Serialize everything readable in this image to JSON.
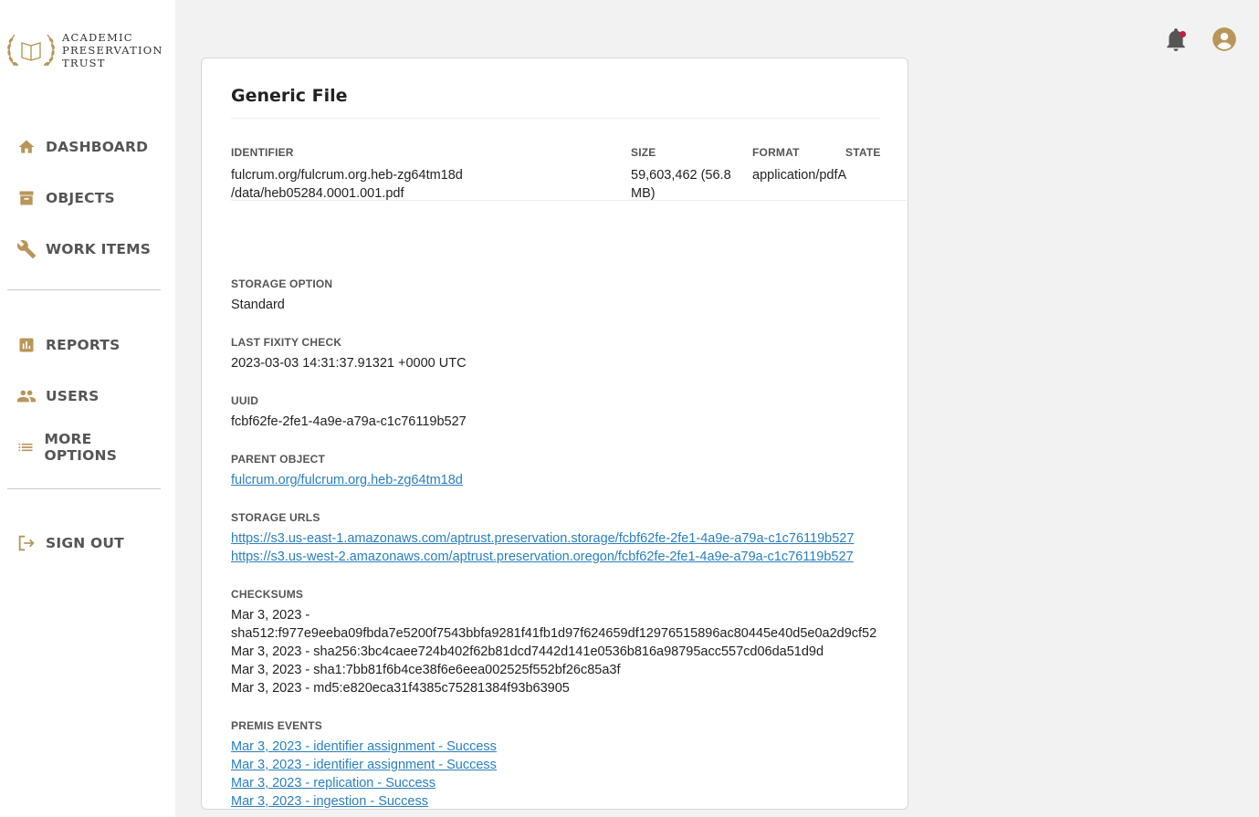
{
  "brand": {
    "line1": "ACADEMIC",
    "line2": "PRESERVATION",
    "line3": "TRUST"
  },
  "nav_primary": [
    {
      "label": "DASHBOARD",
      "icon": "home-icon"
    },
    {
      "label": "OBJECTS",
      "icon": "archive-box-icon"
    },
    {
      "label": "WORK ITEMS",
      "icon": "wrench-icon"
    }
  ],
  "nav_secondary": [
    {
      "label": "REPORTS",
      "icon": "bar-chart-icon"
    },
    {
      "label": "USERS",
      "icon": "users-icon"
    },
    {
      "label": "MORE OPTIONS",
      "icon": "list-icon"
    }
  ],
  "nav_signout": {
    "label": "SIGN OUT",
    "icon": "sign-out-icon"
  },
  "colors": {
    "accent": "#b8965a",
    "link": "#2a7fbf",
    "notification": "#c0203b"
  },
  "card": {
    "title": "Generic File",
    "headers": {
      "identifier": "IDENTIFIER",
      "size": "SIZE",
      "format": "FORMAT",
      "state": "STATE"
    },
    "identifier_line1": "fulcrum.org/fulcrum.org.heb-zg64tm18d",
    "identifier_line2": "/data/heb05284.0001.001.pdf",
    "size_line1": "59,603,462 (56.8",
    "size_line2": "MB)",
    "format": "application/pdfA",
    "state": "",
    "storage_option": {
      "label": "STORAGE OPTION",
      "value": "Standard"
    },
    "last_fixity": {
      "label": "LAST FIXITY CHECK",
      "value": "2023-03-03 14:31:37.91321 +0000 UTC"
    },
    "uuid": {
      "label": "UUID",
      "value": "fcbf62fe-2fe1-4a9e-a79a-c1c76119b527"
    },
    "parent_object": {
      "label": "PARENT OBJECT",
      "value": "fulcrum.org/fulcrum.org.heb-zg64tm18d"
    },
    "storage_urls": {
      "label": "STORAGE URLS",
      "items": [
        "https://s3.us-east-1.amazonaws.com/aptrust.preservation.storage/fcbf62fe-2fe1-4a9e-a79a-c1c76119b527",
        "https://s3.us-west-2.amazonaws.com/aptrust.preservation.oregon/fcbf62fe-2fe1-4a9e-a79a-c1c76119b527"
      ]
    },
    "checksums": {
      "label": "CHECKSUMS",
      "items": [
        "Mar 3, 2023 -",
        "sha512:f977e9eeba09fbda7e5200f7543bbfa9281f41fb1d97f624659df12976515896ac80445e40d5e0a2d9cf52",
        "Mar 3, 2023 - sha256:3bc4caee724b402f62b81dcd7442d141e0536b816a98795acc557cd06da51d9d",
        "Mar 3, 2023 - sha1:7bb81f6b4ce38f6e6eea002525f552bf26c85a3f",
        "Mar 3, 2023 - md5:e820eca31f4385c75281384f93b63905"
      ]
    },
    "premis": {
      "label": "PREMIS EVENTS",
      "items": [
        "Mar 3, 2023 - identifier assignment - Success",
        "Mar 3, 2023 - identifier assignment - Success",
        "Mar 3, 2023 - replication - Success",
        "Mar 3, 2023 - ingestion - Success"
      ]
    }
  }
}
